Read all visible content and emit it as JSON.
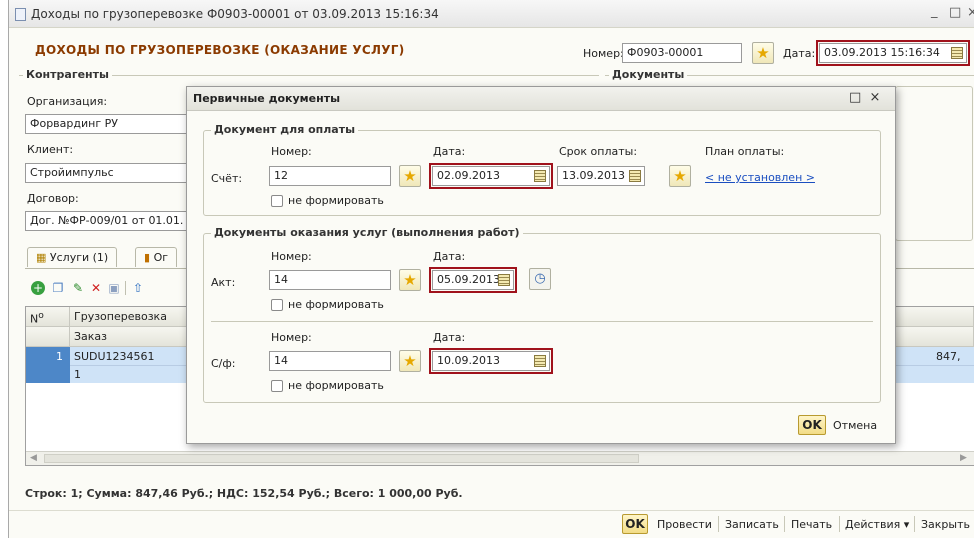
{
  "window": {
    "title": "Доходы по грузоперевозке Ф0903-00001 от 03.09.2013 15:16:34",
    "minimize": "_",
    "maximize": "□",
    "close": "×"
  },
  "header": {
    "heading": "ДОХОДЫ ПО ГРУЗОПЕРЕВОЗКЕ (ОКАЗАНИЕ УСЛУГ)",
    "number_label": "Номер:",
    "number_value": "Ф0903-00001",
    "date_label": "Дата:",
    "date_value": "03.09.2013 15:16:34"
  },
  "left_panel": {
    "contractors_title": "Контрагенты",
    "documents_title": "Документы",
    "org_label": "Организация:",
    "org_value": "Форвардинг РУ",
    "client_label": "Клиент:",
    "client_value": "Стройимпульс",
    "contract_label": "Договор:",
    "contract_value": "Дог. №ФР-009/01 от 01.01."
  },
  "tabs": [
    {
      "label": "Услуги (1)"
    },
    {
      "label": "Ог"
    }
  ],
  "grid": {
    "col_num": "N",
    "col_num_sup": "о",
    "col_main": "Грузоперевозка",
    "sub_header": "Заказ",
    "rows": [
      {
        "num": "1",
        "order": "SUDU1234561",
        "amount": "847,"
      },
      {
        "num": "",
        "order": "1",
        "amount": ""
      }
    ]
  },
  "status_line": "Строк: 1;  Сумма: 847,46 Руб.;  НДС: 152,54 Руб.;  Всего: 1 000,00 Руб.",
  "bottom_bar": {
    "ok": "OK",
    "post": "Провести",
    "save": "Записать",
    "print": "Печать",
    "actions": "Действия ▾",
    "close": "Закрыть"
  },
  "dialog": {
    "title": "Первичные документы",
    "close_icons": "□  ×",
    "payment_group": "Документ для оплаты",
    "number_label": "Номер:",
    "date_label": "Дата:",
    "due_label": "Срок оплаты:",
    "plan_label": "План оплаты:",
    "invoice_label": "Счёт:",
    "invoice_number": "12",
    "invoice_date": "02.09.2013",
    "due_date": "13.09.2013",
    "plan_link": "< не установлен >",
    "no_form": "не формировать",
    "services_group": "Документы оказания услуг (выполнения работ)",
    "act_label": "Акт:",
    "act_number": "14",
    "act_date": "05.09.2013",
    "sf_label": "С/ф:",
    "sf_number": "14",
    "sf_date": "10.09.2013",
    "ok": "OK",
    "cancel": "Отмена"
  }
}
